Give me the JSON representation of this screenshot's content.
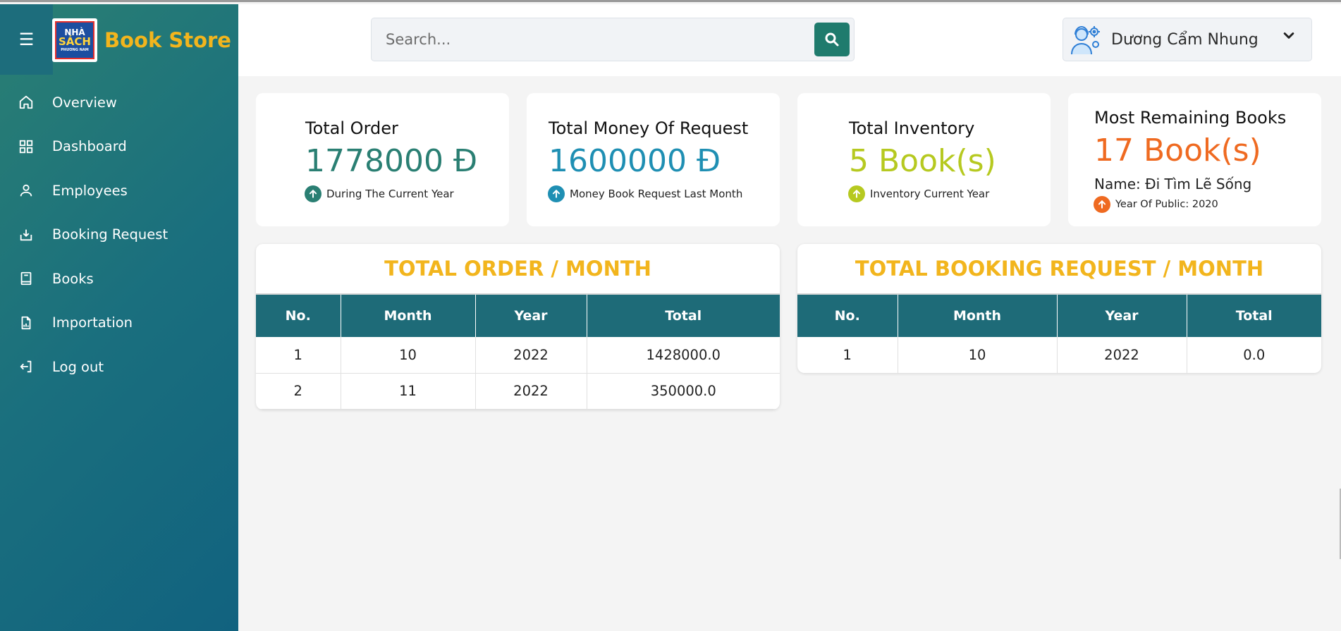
{
  "brand": {
    "logo_line1": "NHÀ",
    "logo_line2": "SÁCH",
    "logo_line3": "PHƯƠNG NAM",
    "name": "Book Store"
  },
  "sidebar": {
    "items": [
      {
        "label": "Overview",
        "icon": "home-icon"
      },
      {
        "label": "Dashboard",
        "icon": "dashboard-icon"
      },
      {
        "label": "Employees",
        "icon": "user-icon"
      },
      {
        "label": "Booking Request",
        "icon": "download-tray-icon"
      },
      {
        "label": "Books",
        "icon": "book-icon"
      },
      {
        "label": "Importation",
        "icon": "file-chart-icon"
      },
      {
        "label": "Log out",
        "icon": "logout-icon"
      }
    ]
  },
  "search": {
    "placeholder": "Search..."
  },
  "user": {
    "name": "Dương Cẩm Nhung"
  },
  "cards": {
    "total_order": {
      "title": "Total Order",
      "value": "1778000 Đ",
      "sub": "During The Current Year",
      "color": "#2a7f73"
    },
    "total_money": {
      "title": "Total Money Of Request",
      "value": "1600000 Đ",
      "sub": "Money Book Request Last Month",
      "color": "#1f8fb3"
    },
    "total_inventory": {
      "title": "Total Inventory",
      "value": "5 Book(s)",
      "sub": "Inventory Current Year",
      "color": "#b6c920"
    },
    "most_remaining": {
      "title": "Most Remaining Books",
      "value": "17 Book(s)",
      "name": "Name: Đi Tìm Lẽ Sống",
      "sub": "Year Of Public: 2020",
      "color": "#ef6a21"
    }
  },
  "order_table": {
    "title": "TOTAL ORDER / MONTH",
    "headers": [
      "No.",
      "Month",
      "Year",
      "Total"
    ],
    "rows": [
      [
        "1",
        "10",
        "2022",
        "1428000.0"
      ],
      [
        "2",
        "11",
        "2022",
        "350000.0"
      ]
    ]
  },
  "booking_table": {
    "title": "TOTAL BOOKING REQUEST / MONTH",
    "headers": [
      "No.",
      "Month",
      "Year",
      "Total"
    ],
    "rows": [
      [
        "1",
        "10",
        "2022",
        "0.0"
      ]
    ]
  }
}
